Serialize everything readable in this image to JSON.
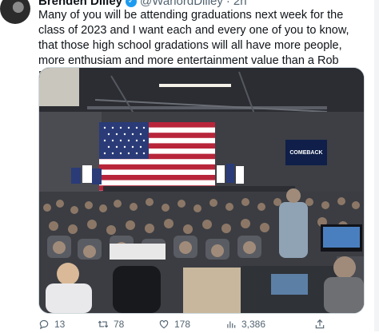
{
  "tweet": {
    "author_name": "Brenden Dilley",
    "handle": "@WarlordDilley",
    "separator": "·",
    "time": "2h",
    "text": "Many of you will be attending graduations next week for the class of 2023 and I want each and every one of you to know, that those high school gradations will all have more people, more enthusiam and more entertainment value than a Rob DeSantis rally.",
    "media": {
      "screen_text": "COMEBACK"
    }
  },
  "actions": {
    "replies": "13",
    "retweets": "78",
    "likes": "178",
    "views": "3,386"
  },
  "icons": {
    "reply": "reply-icon",
    "retweet": "retweet-icon",
    "like": "heart-icon",
    "views": "views-icon",
    "share": "share-icon",
    "verified": "verified-badge-icon"
  },
  "colors": {
    "accent": "#1d9bf0",
    "muted": "#536471",
    "text": "#0f1419"
  }
}
